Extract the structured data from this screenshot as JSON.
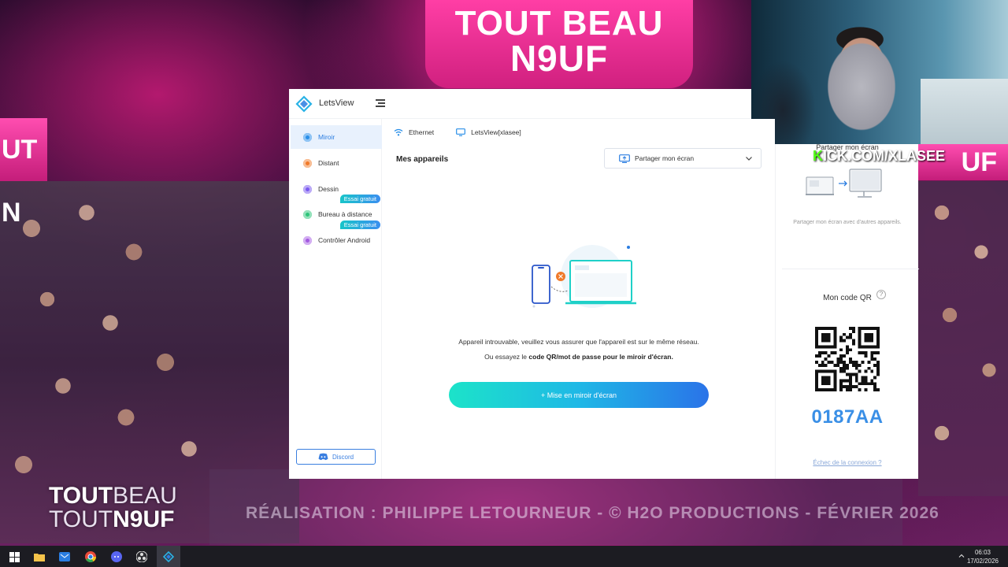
{
  "background": {
    "stage_sign_line1": "TOUT BEAU",
    "stage_sign_line2": "N9UF",
    "side_sign_left": "UT N",
    "side_sign_right": "UF",
    "show_logo_line1_bold": "TOUT",
    "show_logo_line1_thin": "BEAU",
    "show_logo_line2_thin": "TOUT",
    "show_logo_line2_bold": "N9UF",
    "credit": "RÉALISATION : PHILIPPE LETOURNEUR - © H2O PRODUCTIONS - FÉVRIER 2026",
    "kick_prefix": "K",
    "kick_rest": "ICK.COM/XLASEE"
  },
  "app": {
    "title": "LetsView"
  },
  "sidebar": {
    "items": [
      {
        "label": "Miroir",
        "color": "#2a8fe8",
        "active": true
      },
      {
        "label": "Distant",
        "color": "#f07a2a",
        "active": false
      },
      {
        "label": "Dessin",
        "color": "#7a5af0",
        "active": false
      },
      {
        "label": "Bureau à distance",
        "color": "#2ec47a",
        "active": false,
        "badge": "Essai gratuit"
      },
      {
        "label": "Contrôler Android",
        "color": "#a35ae0",
        "active": false,
        "badge": "Essai gratuit"
      }
    ],
    "discord_label": "Discord"
  },
  "content": {
    "network": "Ethernet",
    "device_name": "LetsView[xlasee]",
    "section_title": "Mes appareils",
    "share_select": "Partager mon écran",
    "msg_line1": "Appareil introuvable, veuillez vous assurer que l'appareil est sur le même réseau.",
    "msg_line2_prefix": "Ou essayez le ",
    "msg_line2_bold": "code QR/mot de passe pour le miroir d'écran.",
    "mirror_button": "+ Mise en miroir d'écran"
  },
  "right_panel": {
    "share_title": "Partager mon écran",
    "share_desc": "Partager mon écran avec d'autres appareils.",
    "qr_title": "Mon code QR",
    "help": "?",
    "code": "0187AA",
    "connection_fail": "Échec de la connexion ?"
  },
  "taskbar": {
    "time": "06:03",
    "date": "17/02/2026"
  },
  "colors": {
    "accent": "#2a7de1",
    "code_blue": "#3a8fe6",
    "button_start": "#1ce3c9",
    "button_end": "#2a73e8"
  }
}
